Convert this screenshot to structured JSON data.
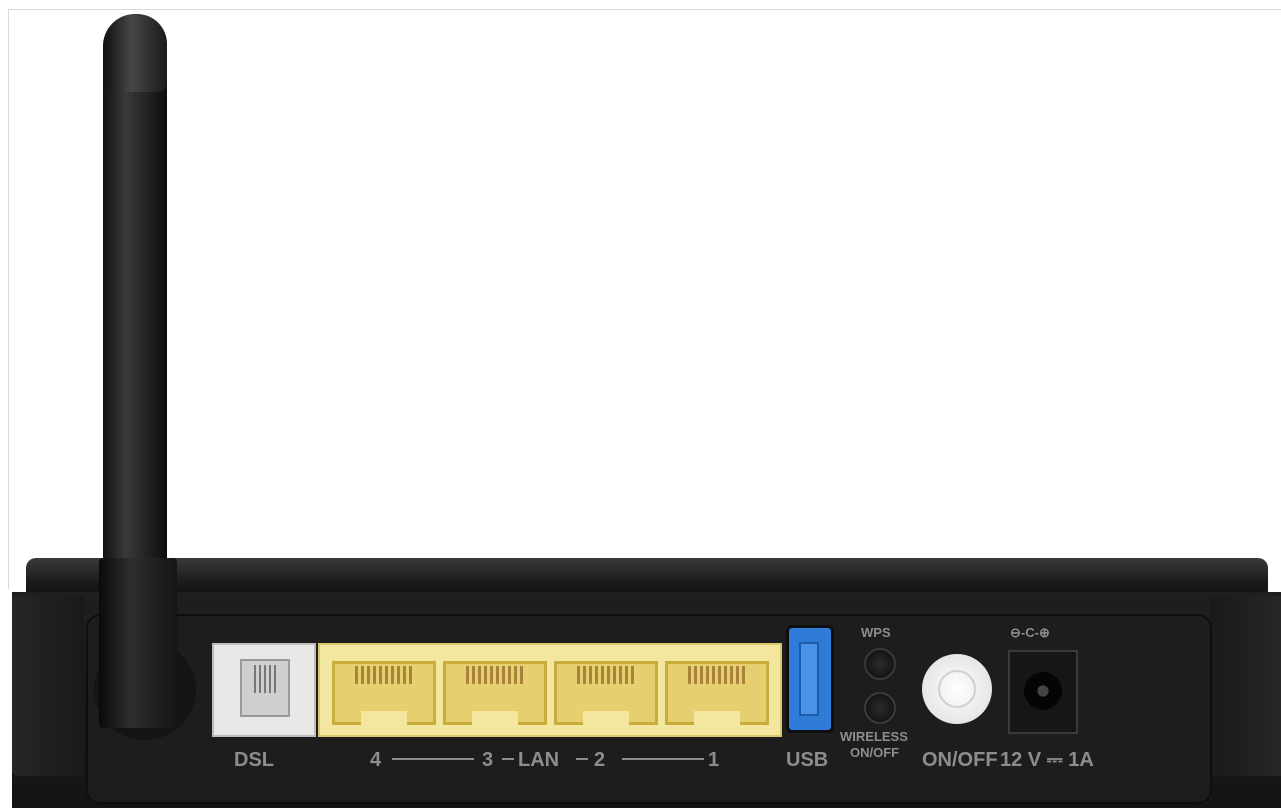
{
  "labels": {
    "dsl": "DSL",
    "lan_4": "4",
    "lan_3": "3",
    "lan": "LAN",
    "lan_2": "2",
    "lan_1": "1",
    "usb": "USB",
    "wps": "WPS",
    "wireless_line1": "WIRELESS",
    "wireless_line2": "ON/OFF",
    "power": "ON/OFF",
    "polarity": "⊖-C-⊕",
    "power_rating": "12 V ⎓ 1A"
  },
  "colors": {
    "body": "#1d1d1d",
    "lan_ports": "#f3e7a0",
    "dsl_port": "#e8e8e8",
    "usb_port": "#2f7bd8",
    "power_button": "#ffffff",
    "label_text": "#8d8d8d"
  }
}
